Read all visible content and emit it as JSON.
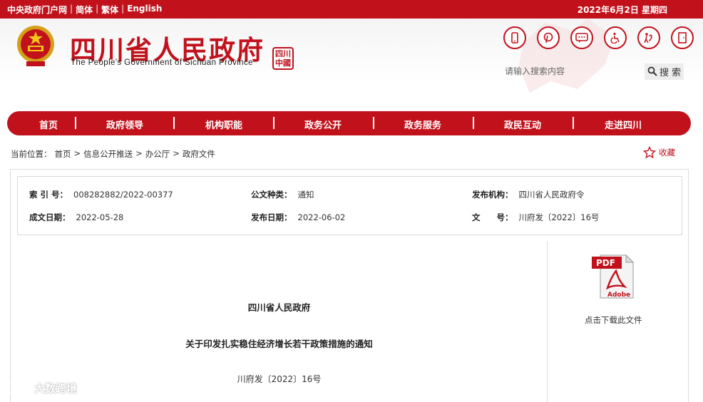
{
  "topbar": {
    "links": [
      "中央政府门户网",
      "简体",
      "繁体",
      "English"
    ],
    "date": "2022年6月2日 星期四"
  },
  "header": {
    "title": "四川省人民政府",
    "subtitle": "The People's Government of Sichuan Province",
    "seal_text": "四川中國"
  },
  "search": {
    "placeholder": "请输入搜索内容",
    "button_label": "搜 索"
  },
  "quick_icons": [
    "mobile-icon",
    "pinterest-icon",
    "chat-icon",
    "accessibility-icon",
    "elderly-care-icon",
    "exit-icon"
  ],
  "nav": {
    "items": [
      "首页",
      "政府领导",
      "机构职能",
      "政务公开",
      "政务服务",
      "政民互动",
      "走进四川"
    ]
  },
  "breadcrumb": {
    "label": "当前位置：",
    "items": [
      "首页",
      ">",
      "信息公开推送",
      ">",
      "办公厅",
      ">",
      "政府文件"
    ]
  },
  "favorite": {
    "label": "收藏"
  },
  "meta": {
    "index_key": "索 引 号：",
    "index_val": "008282882/2022-00377",
    "type_key": "公文种类：",
    "type_val": "通知",
    "org_key": "发布机构：",
    "org_val": "四川省人民政府令",
    "created_key": "成文日期：",
    "created_val": "2022-05-28",
    "published_key": "发布日期：",
    "published_val": "2022-06-02",
    "docno_key": "文　　号：",
    "docno_val": "川府发〔2022〕16号"
  },
  "download": {
    "pdf_badge": "PDF",
    "pdf_brand": "Adobe",
    "label": "点击下载此文件"
  },
  "document": {
    "issuer": "四川省人民政府",
    "title": "关于印发扎实稳住经济增长若干政策措施的通知",
    "number": "川府发〔2022〕16号"
  },
  "watermark": {
    "text": "大数跨境"
  },
  "colors": {
    "brand_red": "#c1121c"
  }
}
